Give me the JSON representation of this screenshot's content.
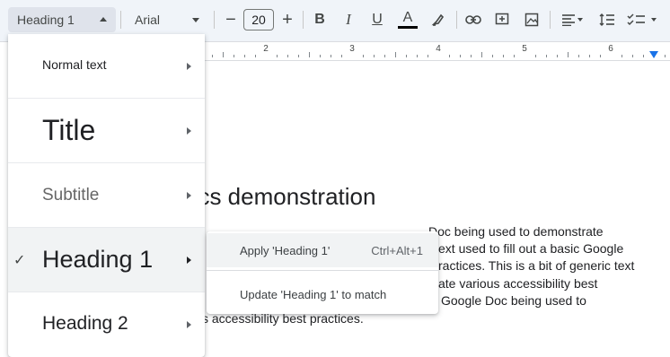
{
  "toolbar": {
    "style_value": "Heading 1",
    "font_value": "Arial",
    "font_size": "20",
    "minus_label": "−",
    "plus_label": "+",
    "bold_label": "B",
    "italic_label": "I",
    "underline_label": "U",
    "text_color_label": "A",
    "icons": [
      "link-icon",
      "add-comment-icon",
      "insert-image-icon",
      "align-left-icon",
      "line-spacing-icon",
      "checklist-icon"
    ]
  },
  "ruler": {
    "numbers": [
      "2",
      "3",
      "4",
      "5",
      "6"
    ]
  },
  "document": {
    "heading_fragment": "ocs demonstration",
    "para_lines": [
      "Doc being used to demonstrate",
      "ext used to fill out a basic Google",
      "ractices. This is a bit of generic text",
      "ate various accessibility best",
      "Google Doc being used to"
    ],
    "last_line": "s accessibility best practices."
  },
  "style_menu": {
    "items": [
      {
        "label": "Normal text"
      },
      {
        "label": "Title"
      },
      {
        "label": "Subtitle"
      },
      {
        "label": "Heading 1",
        "checked": true
      },
      {
        "label": "Heading 2"
      }
    ],
    "check_glyph": "✓"
  },
  "submenu": {
    "apply_label": "Apply 'Heading 1'",
    "apply_shortcut": "Ctrl+Alt+1",
    "update_label": "Update 'Heading 1' to match"
  },
  "colors": {
    "accent": "#1a73e8",
    "toolbar_bg": "#f0f4f9",
    "highlight": "#f1f3f4"
  }
}
